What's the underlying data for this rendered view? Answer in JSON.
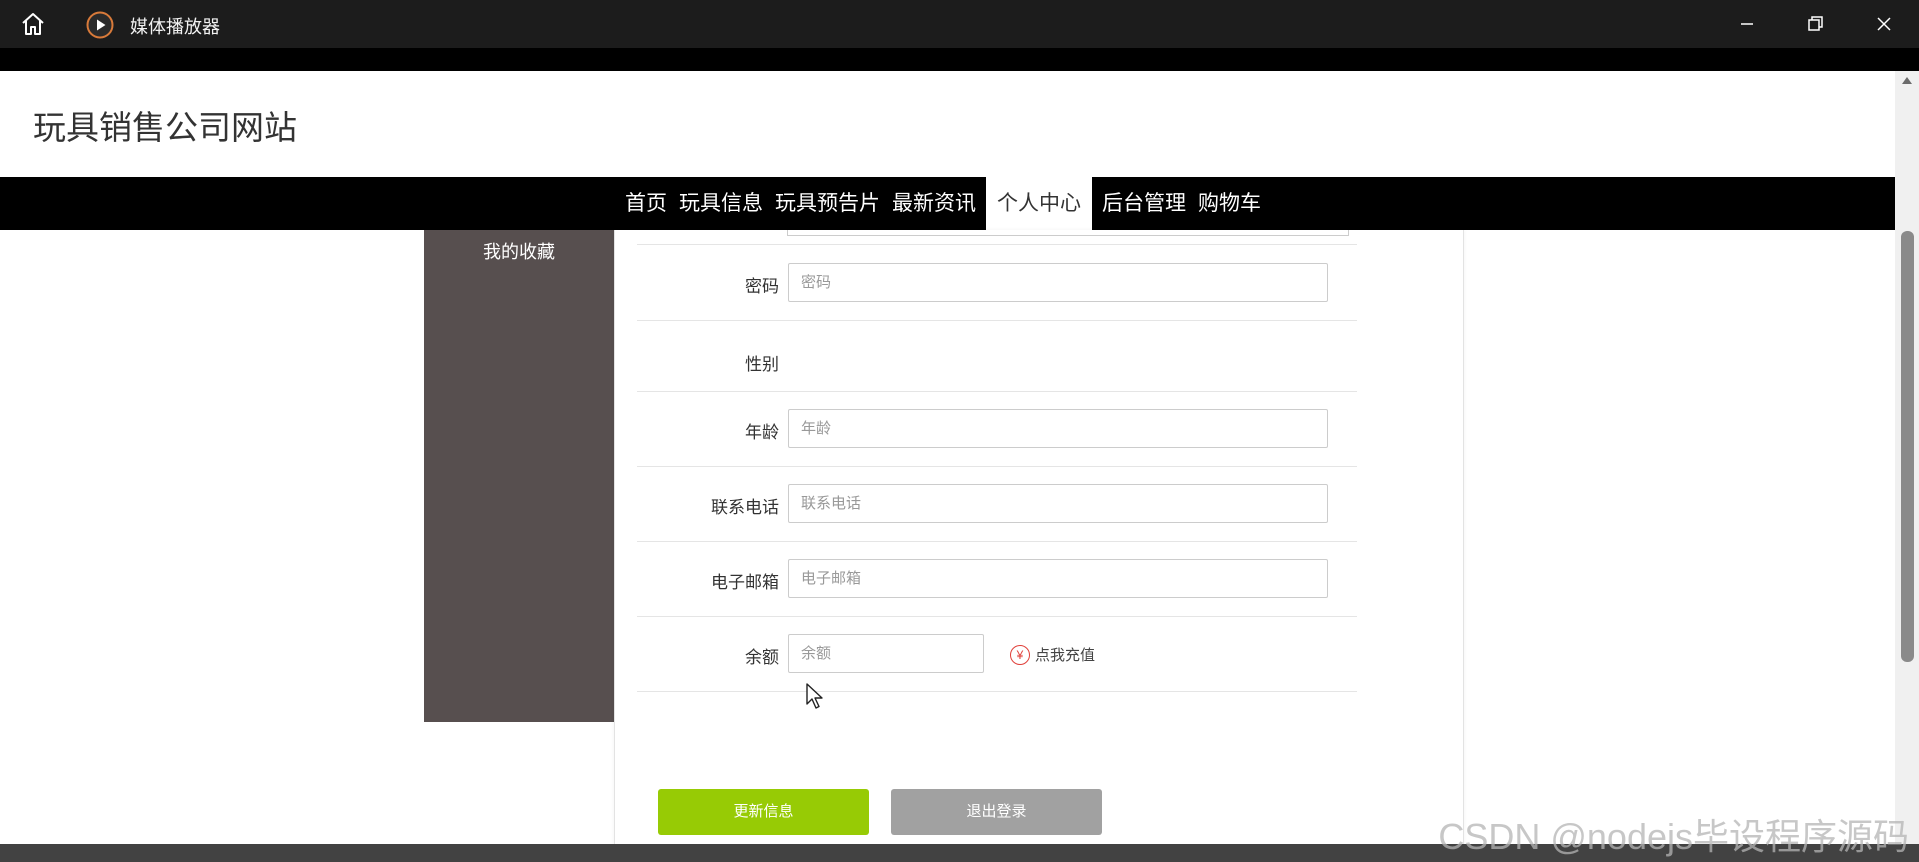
{
  "window": {
    "title": "媒体播放器",
    "icons": {
      "home": "home-icon",
      "app": "play-icon",
      "minimize": "minimize-icon",
      "restore": "restore-icon",
      "close": "close-icon"
    }
  },
  "site": {
    "title": "玩具销售公司网站",
    "nav": [
      "首页",
      "玩具信息",
      "玩具预告片",
      "最新资讯",
      "个人中心",
      "后台管理",
      "购物车"
    ],
    "active_nav": "个人中心"
  },
  "sidebar": {
    "items": [
      "我的收藏"
    ]
  },
  "form": {
    "password": {
      "label": "密码",
      "placeholder": "密码"
    },
    "gender": {
      "label": "性别"
    },
    "age": {
      "label": "年龄",
      "placeholder": "年龄"
    },
    "phone": {
      "label": "联系电话",
      "placeholder": "联系电话"
    },
    "email": {
      "label": "电子邮箱",
      "placeholder": "电子邮箱"
    },
    "balance": {
      "label": "余额",
      "placeholder": "余额",
      "recharge": "点我充值"
    },
    "update_button": "更新信息",
    "logout_button": "退出登录"
  },
  "colors": {
    "nav_bg": "#000000",
    "sidebar_bg": "#574f4f",
    "update_button": "#97cb05",
    "logout_button": "#a1a1a1",
    "recharge_icon": "#e0403a"
  },
  "watermark": "CSDN @nodejs毕设程序源码"
}
